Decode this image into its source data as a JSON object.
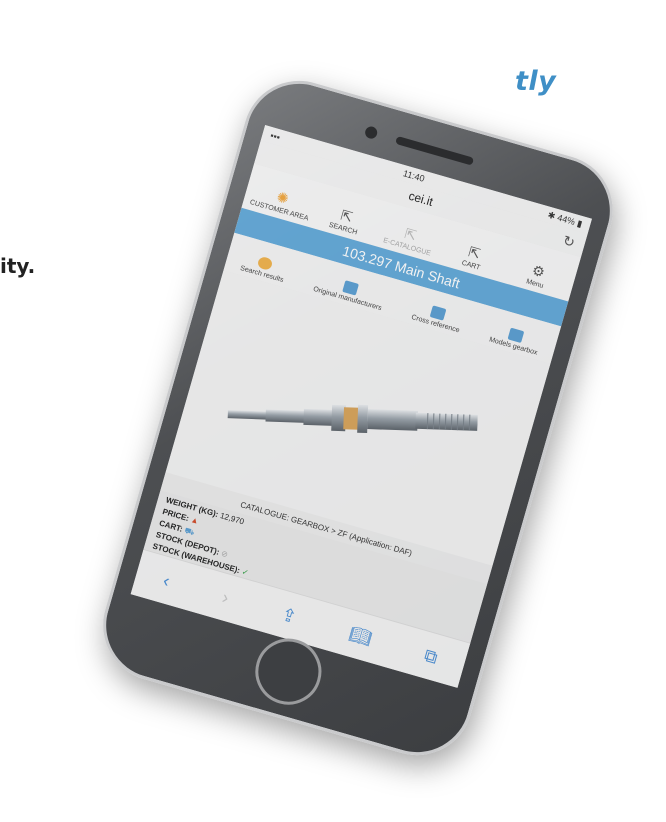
{
  "background": {
    "tagline_fragment": "tly",
    "line_fragment": "ity."
  },
  "status_bar": {
    "time": "11:40",
    "battery": "44%"
  },
  "browser": {
    "url": "cei.it"
  },
  "toolbar": {
    "items": [
      {
        "label": "CUSTOMER AREA",
        "icon": "customer-icon"
      },
      {
        "label": "SEARCH",
        "icon": "share-arrow-icon"
      },
      {
        "label": "E-CATALOGUE",
        "icon": "share-arrow-icon"
      },
      {
        "label": "CART",
        "icon": "share-arrow-icon"
      },
      {
        "label": "Menu",
        "icon": "gear-icon"
      }
    ]
  },
  "banner": {
    "title": "103.297 Main Shaft"
  },
  "subnav": {
    "items": [
      {
        "label": "Search results"
      },
      {
        "label": "Original manufacturers"
      },
      {
        "label": "Cross reference"
      },
      {
        "label": "Models gearbox"
      }
    ]
  },
  "catalogue_line": "CATALOGUE: GEARBOX > ZF (Application: DAF)",
  "specs": {
    "weight_label": "WEIGHT (KG):",
    "weight_value": "12,970",
    "price_label": "PRICE:",
    "cart_label": "CART:",
    "stock_depot_label": "STOCK (DEPOT):",
    "stock_warehouse_label": "STOCK (WAREHOUSE):"
  },
  "colors": {
    "accent": "#62a9d9",
    "orange": "#f0a53c",
    "ok": "#3aa34b",
    "warn": "#d24b2a"
  }
}
